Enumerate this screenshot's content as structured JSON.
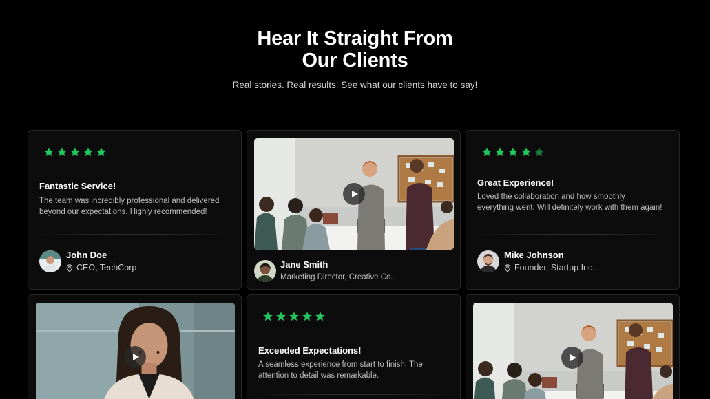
{
  "hero": {
    "title": "Hear It Straight From Our Clients",
    "subtitle": "Real stories. Real results. See what our clients have to say!"
  },
  "colors": {
    "accent": "#22c55e",
    "background": "#000000",
    "card": "#0c0c0c"
  },
  "cards": [
    {
      "rating": 5,
      "title": "Fantastic Service!",
      "text": "The team was incredibly professional and delivered beyond our expectations. Highly recommended!",
      "author": {
        "name": "John Doe",
        "role": "CEO, TechCorp",
        "icon": "location-pin-icon"
      }
    },
    {
      "media": "meeting-video",
      "author": {
        "name": "Jane Smith",
        "role": "Marketing Director, Creative Co."
      }
    },
    {
      "rating": 4,
      "title": "Great Experience!",
      "text": "Loved the collaboration and how smoothly everything went. Will definitely work with them again!",
      "author": {
        "name": "Mike Johnson",
        "role": "Founder, Startup Inc.",
        "icon": "location-pin-icon"
      }
    },
    {
      "media": "portrait-video"
    },
    {
      "rating": 5,
      "title": "Exceeded Expectations!",
      "text": "A seamless experience from start to finish. The attention to detail was remarkable."
    },
    {
      "media": "meeting-video"
    }
  ]
}
